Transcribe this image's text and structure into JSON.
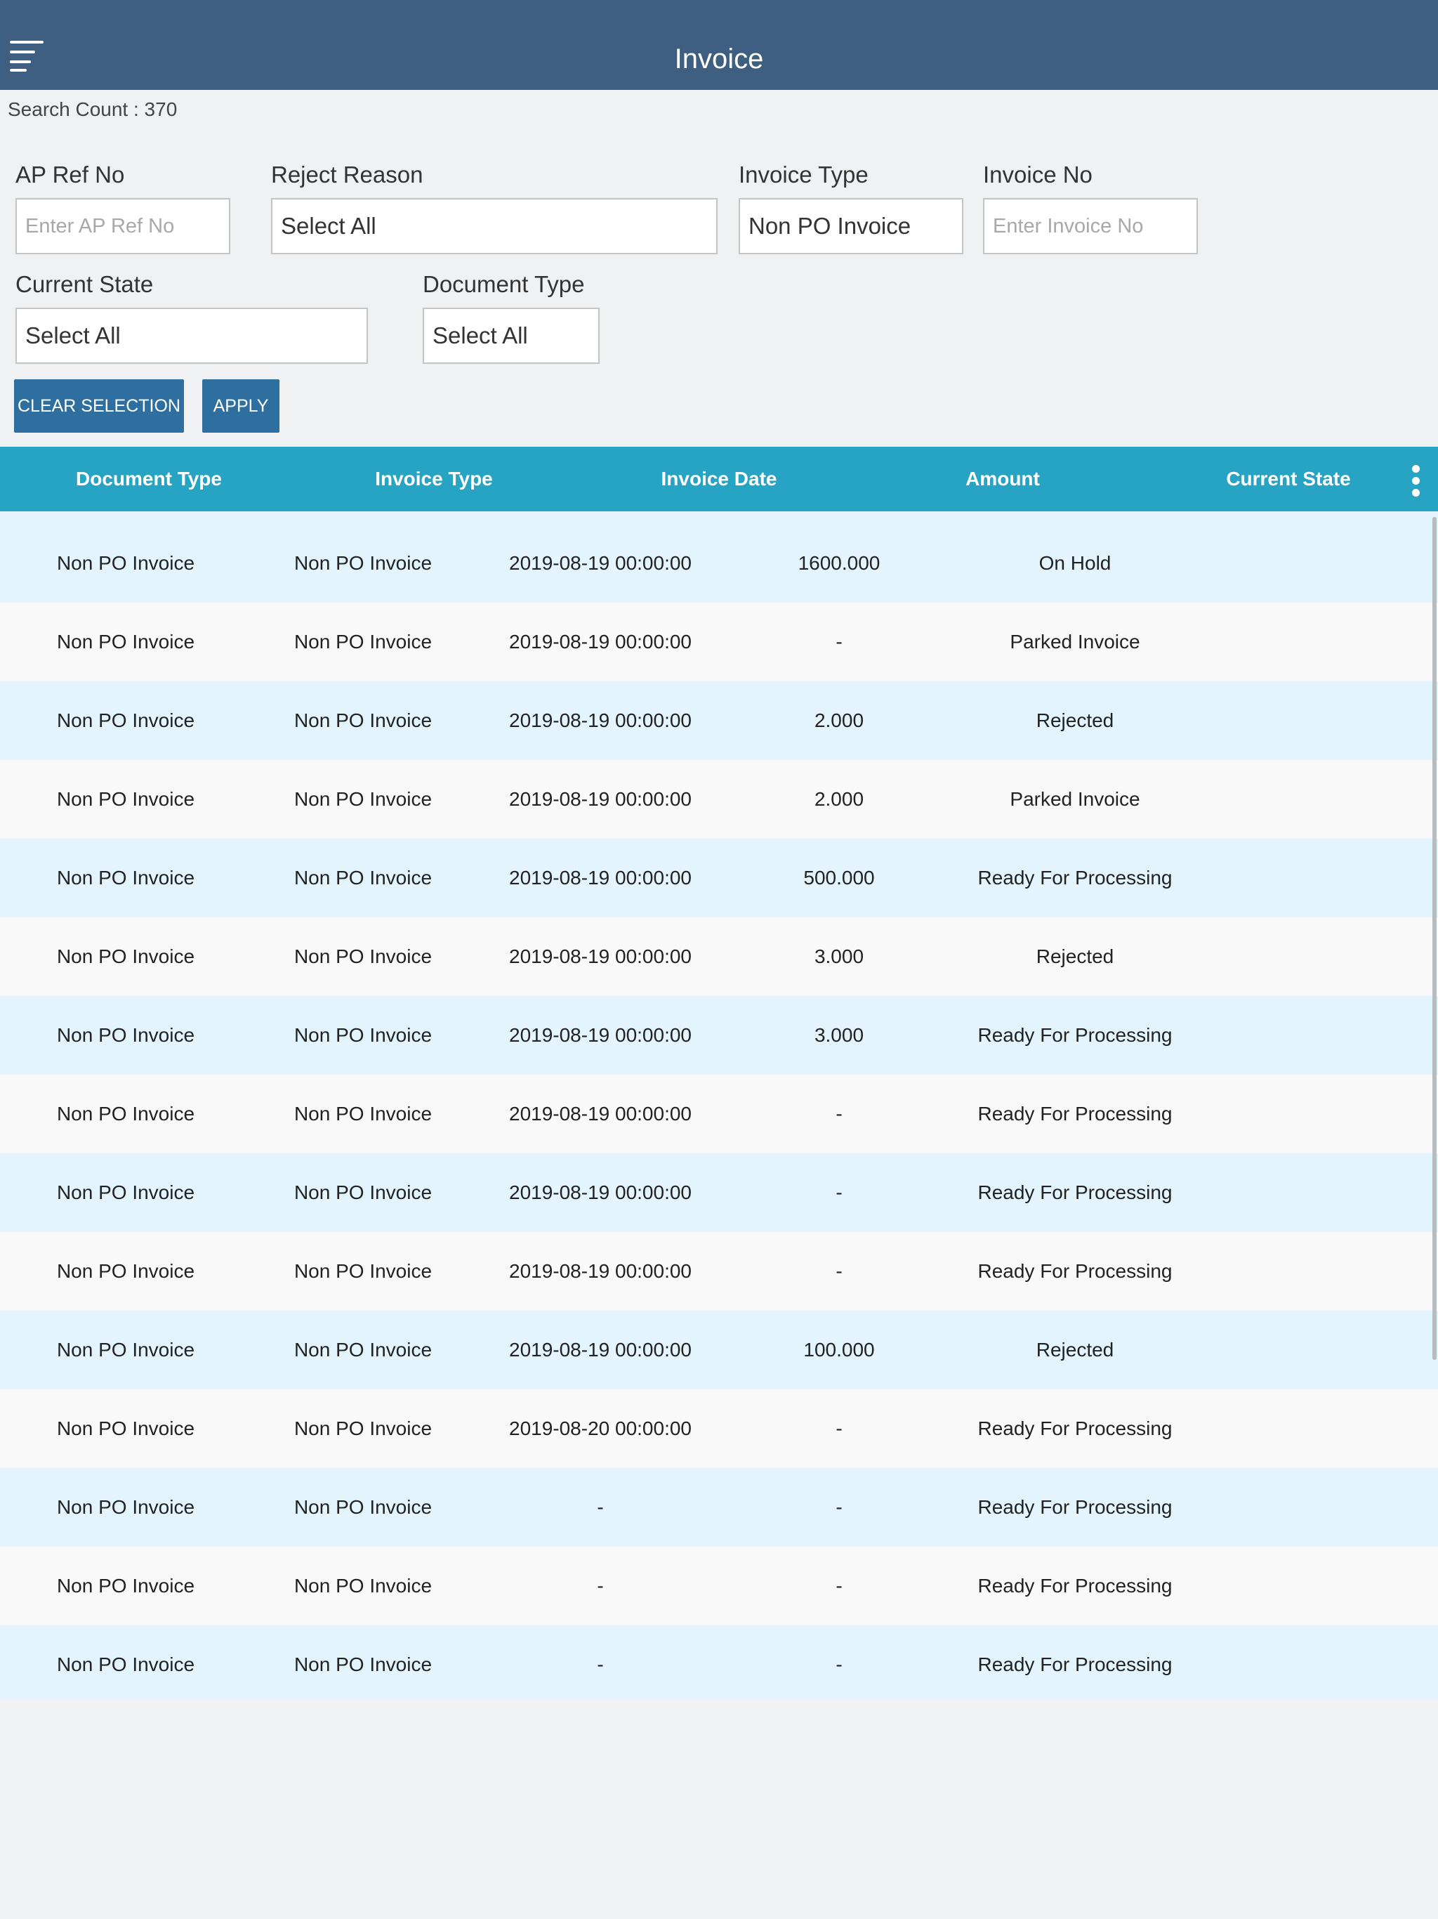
{
  "header": {
    "title": "Invoice",
    "menu_icon": "hamburger-menu-icon",
    "color": "#3f5f82"
  },
  "search_count": "Search Count : 370",
  "filters": {
    "ap_ref_no": {
      "label": "AP Ref No",
      "placeholder": "Enter AP Ref No"
    },
    "reject_reason": {
      "label": "Reject Reason",
      "value": "Select All"
    },
    "invoice_type": {
      "label": "Invoice Type",
      "value": "Non PO Invoice"
    },
    "invoice_no": {
      "label": "Invoice No",
      "placeholder": "Enter Invoice No"
    },
    "current_state": {
      "label": "Current State",
      "value": "Select All"
    },
    "document_type": {
      "label": "Document Type",
      "value": "Select All"
    }
  },
  "buttons": {
    "clear_selection": "CLEAR SELECTION",
    "apply": "APPLY",
    "color": "#2e6fa0"
  },
  "table": {
    "header_color": "#27a4c3",
    "columns": [
      "Document Type",
      "Invoice Type",
      "Invoice Date",
      "Amount",
      "Current State"
    ],
    "more_icon": "more-vertical-icon",
    "rows": [
      [
        "Non PO Invoice",
        "Non PO Invoice",
        "2019-08-19 00:00:00",
        "1600.000",
        "On Hold"
      ],
      [
        "Non PO Invoice",
        "Non PO Invoice",
        "2019-08-19 00:00:00",
        "-",
        "Parked Invoice"
      ],
      [
        "Non PO Invoice",
        "Non PO Invoice",
        "2019-08-19 00:00:00",
        "2.000",
        "Rejected"
      ],
      [
        "Non PO Invoice",
        "Non PO Invoice",
        "2019-08-19 00:00:00",
        "2.000",
        "Parked Invoice"
      ],
      [
        "Non PO Invoice",
        "Non PO Invoice",
        "2019-08-19 00:00:00",
        "500.000",
        "Ready For Processing"
      ],
      [
        "Non PO Invoice",
        "Non PO Invoice",
        "2019-08-19 00:00:00",
        "3.000",
        "Rejected"
      ],
      [
        "Non PO Invoice",
        "Non PO Invoice",
        "2019-08-19 00:00:00",
        "3.000",
        "Ready For Processing"
      ],
      [
        "Non PO Invoice",
        "Non PO Invoice",
        "2019-08-19 00:00:00",
        "-",
        "Ready For Processing"
      ],
      [
        "Non PO Invoice",
        "Non PO Invoice",
        "2019-08-19 00:00:00",
        "-",
        "Ready For Processing"
      ],
      [
        "Non PO Invoice",
        "Non PO Invoice",
        "2019-08-19 00:00:00",
        "-",
        "Ready For Processing"
      ],
      [
        "Non PO Invoice",
        "Non PO Invoice",
        "2019-08-19 00:00:00",
        "100.000",
        "Rejected"
      ],
      [
        "Non PO Invoice",
        "Non PO Invoice",
        "2019-08-20 00:00:00",
        "-",
        "Ready For Processing"
      ],
      [
        "Non PO Invoice",
        "Non PO Invoice",
        "-",
        "-",
        "Ready For Processing"
      ],
      [
        "Non PO Invoice",
        "Non PO Invoice",
        "-",
        "-",
        "Ready For Processing"
      ],
      [
        "Non PO Invoice",
        "Non PO Invoice",
        "-",
        "-",
        "Ready For Processing"
      ]
    ]
  }
}
